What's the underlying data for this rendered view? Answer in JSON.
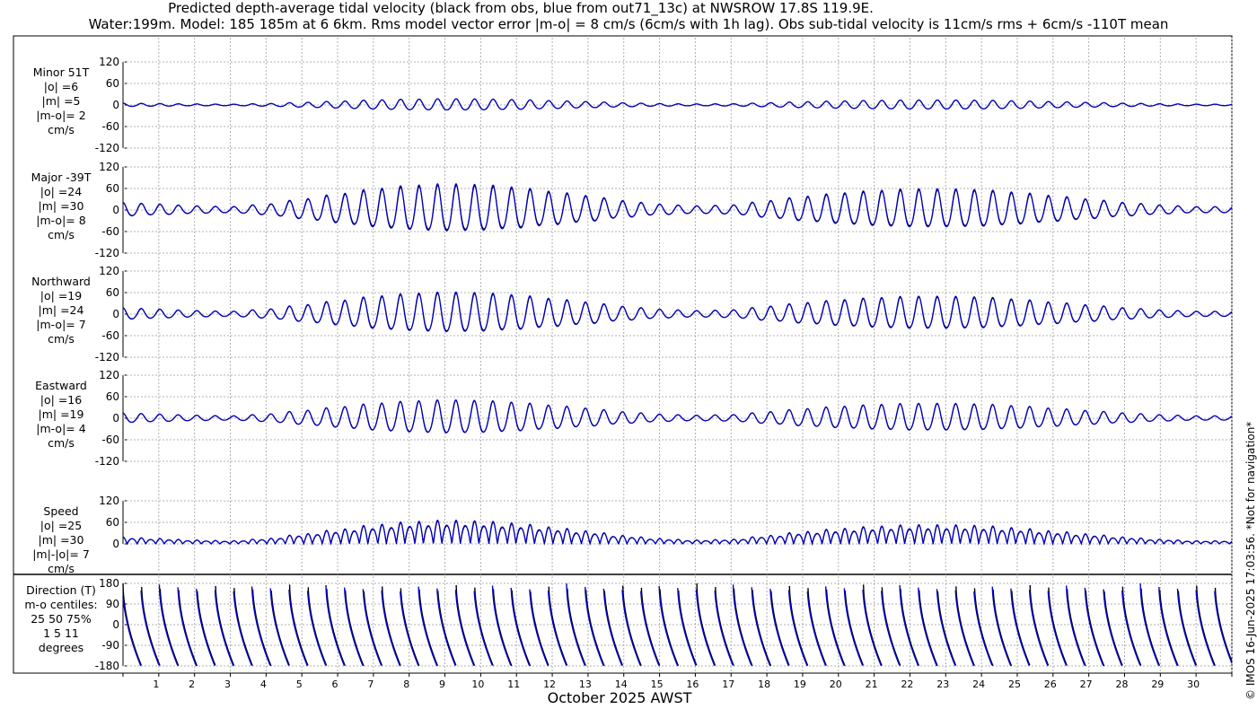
{
  "title_line1": "Predicted depth-average tidal velocity (black from obs, blue from out71_13c) at NWSROW 17.8S 119.9E.",
  "title_line2": "Water:199m. Model: 185 185m at 6 6km. Rms model vector error |m-o| = 8 cm/s (6cm/s with 1h lag). Obs sub-tidal velocity is 11cm/s rms + 6cm/s -110T mean",
  "copyright": "© IMOS 16-Jun-2025 17:03:56. *Not for navigation*",
  "xlabel": "October 2025 AWST",
  "colors": {
    "obs": "#000000",
    "model": "#0000cc",
    "grid": "#b0b0b0"
  },
  "chart_data": {
    "type": "line",
    "x_unit": "day of October 2025",
    "x_range": [
      0.0,
      31.0
    ],
    "x_ticks": [
      1,
      2,
      3,
      4,
      5,
      6,
      7,
      8,
      9,
      10,
      11,
      12,
      13,
      14,
      15,
      16,
      17,
      18,
      19,
      20,
      21,
      22,
      23,
      24,
      25,
      26,
      27,
      28,
      29,
      30
    ],
    "series_legend": {
      "obs": "black from obs",
      "model": "blue from out71_13c"
    },
    "panels": [
      {
        "id": "minor",
        "labels": [
          "Minor 51T",
          "|o| =6",
          "|m| =5",
          "|m-o|= 2",
          "cm/s"
        ],
        "ylim": [
          -120,
          120
        ],
        "yticks": [
          120,
          60,
          0,
          -60,
          -120
        ],
        "amplitude_scale": 0.25,
        "mod_scale": 1.0,
        "phase_shift": 0.0
      },
      {
        "id": "major",
        "labels": [
          "Major -39T",
          "|o| =24",
          "|m| =30",
          "|m-o|= 8",
          "cm/s"
        ],
        "ylim": [
          -120,
          120
        ],
        "yticks": [
          120,
          60,
          0,
          -60,
          -120
        ],
        "amplitude_scale": 1.0,
        "mod_scale": 1.06,
        "phase_shift": 0.0
      },
      {
        "id": "northward",
        "labels": [
          "Northward",
          "|o| =19",
          "|m| =24",
          "|m-o|= 7",
          "cm/s"
        ],
        "ylim": [
          -120,
          120
        ],
        "yticks": [
          120,
          60,
          0,
          -60,
          -120
        ],
        "amplitude_scale": 0.85,
        "mod_scale": 1.05,
        "phase_shift": 0.05
      },
      {
        "id": "eastward",
        "labels": [
          "Eastward",
          "|o| =16",
          "|m| =19",
          "|m-o|= 4",
          "cm/s"
        ],
        "ylim": [
          -120,
          120
        ],
        "yticks": [
          120,
          60,
          0,
          -60,
          -120
        ],
        "amplitude_scale": 0.72,
        "mod_scale": 1.03,
        "phase_shift": 0.1
      },
      {
        "id": "speed",
        "labels": [
          "Speed",
          "|o| =25",
          "|m| =30",
          "|m|-|o|= 7",
          "cm/s"
        ],
        "ylim": [
          0,
          120
        ],
        "yticks": [
          120,
          60,
          0
        ],
        "amplitude_scale": 1.0,
        "mod_scale": 1.04,
        "phase_shift": 0.0
      },
      {
        "id": "direction",
        "labels": [
          "Direction (T)",
          "m-o centiles:",
          "25  50  75%",
          "1    5   11",
          "degrees"
        ],
        "ylim": [
          -180,
          180
        ],
        "yticks": [
          180,
          90,
          0,
          -90,
          -180
        ]
      }
    ],
    "tidal_period_days": 0.5175,
    "envelope_days": [
      0,
      1,
      2,
      3,
      4,
      5,
      6,
      7,
      8,
      9,
      10,
      11,
      12,
      13,
      14,
      15,
      16,
      17,
      18,
      19,
      20,
      21,
      22,
      23,
      24,
      25,
      26,
      27,
      28,
      29,
      30,
      31
    ],
    "envelope_major_amplitude": [
      18,
      14,
      10,
      8,
      14,
      26,
      38,
      50,
      58,
      62,
      60,
      54,
      44,
      34,
      22,
      14,
      10,
      12,
      22,
      32,
      40,
      46,
      50,
      50,
      48,
      42,
      34,
      26,
      18,
      12,
      8,
      8
    ]
  }
}
